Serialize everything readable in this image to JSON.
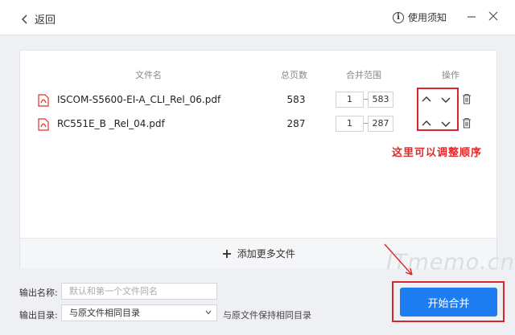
{
  "header": {
    "back_label": "返回",
    "help_label": "使用须知"
  },
  "table": {
    "columns": {
      "name": "文件名",
      "pages": "总页数",
      "range": "合并范围",
      "ops": "操作"
    },
    "rows": [
      {
        "name": "ISCOM-S5600-EI-A_CLI_Rel_06.pdf",
        "pages": "583",
        "from": "1",
        "to": "583"
      },
      {
        "name": "RC551E_B _Rel_04.pdf",
        "pages": "287",
        "from": "1",
        "to": "287"
      }
    ]
  },
  "annotation": "这里可以调整顺序",
  "add_files_label": "添加更多文件",
  "watermark": "ITmemo.cn",
  "output": {
    "name_label": "输出名称:",
    "name_placeholder": "默认和第一个文件同名",
    "dir_label": "输出目录:",
    "dir_value": "与原文件相同目录",
    "dir_note": "与原文件保持相同目录"
  },
  "start_label": "开始合并",
  "colors": {
    "accent": "#1f7df2",
    "highlight": "#d8262a",
    "pdf": "#e0302a"
  }
}
